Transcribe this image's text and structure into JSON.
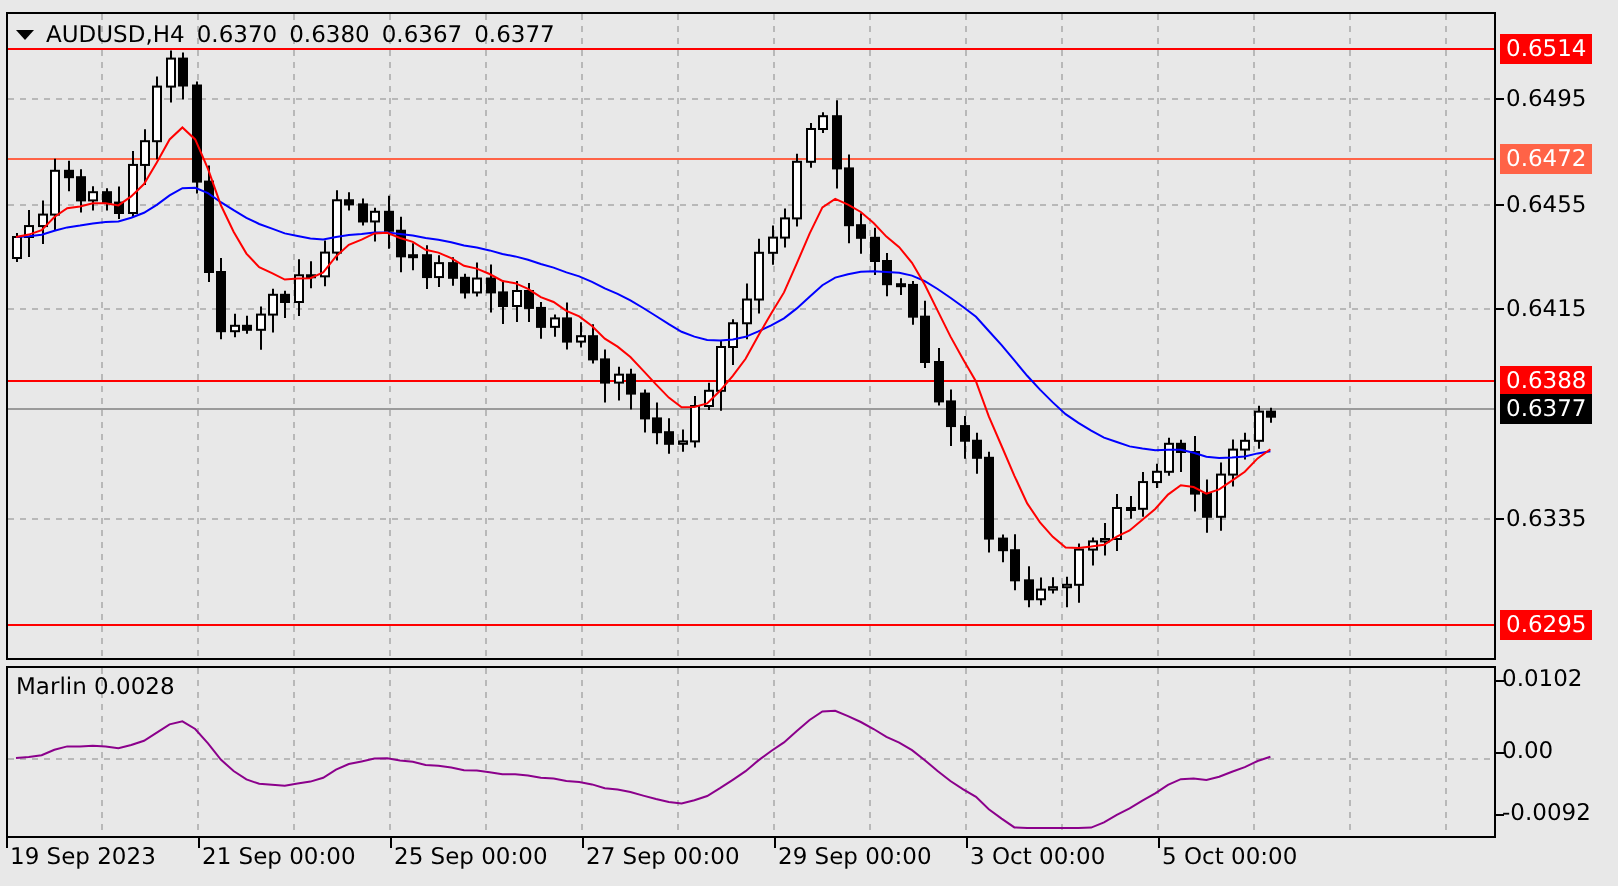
{
  "header": {
    "symbol": "AUDUSD,H4",
    "ohlc": [
      "0.6370",
      "0.6380",
      "0.6367",
      "0.6377"
    ]
  },
  "price_axis": {
    "ticks": [
      "0.6495",
      "0.6455",
      "0.6415",
      "0.6335"
    ],
    "levels": [
      {
        "label": "0.6514",
        "kind": "level",
        "color": "#ff0000"
      },
      {
        "label": "0.6472",
        "kind": "level",
        "color": "#ff6347"
      },
      {
        "label": "0.6388",
        "kind": "level",
        "color": "#ff0000"
      },
      {
        "label": "0.6377",
        "kind": "current",
        "color": "#000000"
      },
      {
        "label": "0.6295",
        "kind": "level",
        "color": "#ff0000"
      }
    ]
  },
  "indicator": {
    "label": "Marlin 0.0028",
    "ticks": [
      "0.0102",
      "0.00",
      "-0.0092"
    ]
  },
  "time_axis": [
    "19 Sep 2023",
    "21 Sep 00:00",
    "25 Sep 00:00",
    "27 Sep 00:00",
    "29 Sep 00:00",
    "3 Oct 00:00",
    "5 Oct 00:00"
  ]
}
